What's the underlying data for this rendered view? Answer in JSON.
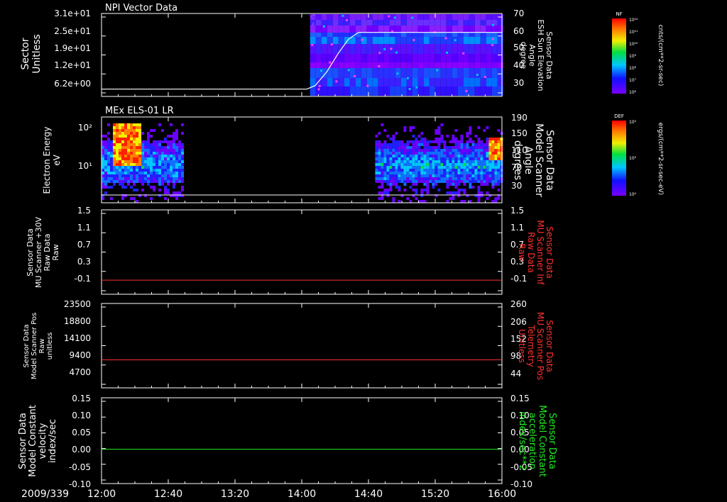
{
  "colors": {
    "background": "#000000",
    "foreground": "#ffffff",
    "red_line": "#ff3030",
    "green_line": "#22ee22"
  },
  "time_axis": {
    "date": "2009/339",
    "ticks": [
      "12:00",
      "12:40",
      "13:20",
      "14:00",
      "14:40",
      "15:20",
      "16:00"
    ]
  },
  "colorbars": [
    {
      "title": "NF",
      "unit": "cnts/(cm**2-sr-sec)",
      "tick_labels": [
        "10¹²",
        "10¹¹",
        "10¹⁰",
        "10⁹",
        "10⁸",
        "10⁷",
        "10⁶"
      ]
    },
    {
      "title": "DEF",
      "unit": "ergs/(cm**2-sr-sec-eV)",
      "tick_labels": [
        "10⁴",
        "10²",
        "10⁰"
      ]
    }
  ],
  "chart_data": [
    {
      "type": "heatmap",
      "title": "NPI Vector Data",
      "ylabel": [
        "Sector",
        "Unitless"
      ],
      "yticks": [
        "3.1e+01",
        "2.5e+01",
        "1.9e+01",
        "1.2e+01",
        "6.2e+00"
      ],
      "y2label": [
        "Sensor Data",
        "ESH Sun Elevation",
        "Angle",
        "degree"
      ],
      "y2ticks": [
        "70",
        "60",
        "50",
        "40",
        "30"
      ],
      "data_coverage_start": "14:05",
      "overlay_line": {
        "name": "ESH Sun Elevation Angle",
        "points": [
          [
            "12:00",
            26
          ],
          [
            "14:03",
            26
          ],
          [
            "14:08",
            28
          ],
          [
            "14:15",
            36
          ],
          [
            "14:22",
            47
          ],
          [
            "14:28",
            55
          ],
          [
            "14:34",
            59
          ],
          [
            "16:00",
            59
          ]
        ]
      }
    },
    {
      "type": "heatmap",
      "title": "MEx ELS-01 LR",
      "ylabel": [
        "Electron Energy",
        "eV"
      ],
      "yticks": [
        "10²",
        "10¹"
      ],
      "y2label": [
        "Sensor Data",
        "Model Scanner",
        "Angle",
        "degrees"
      ],
      "y2ticks": [
        "190",
        "150",
        "110",
        "70",
        "30"
      ],
      "data_coverage": [
        [
          "12:00",
          "12:48"
        ],
        [
          "14:44",
          "16:00"
        ]
      ],
      "overlay_line": {
        "name": "Model Scanner Angle",
        "points": [
          [
            "12:00",
            10
          ],
          [
            "16:00",
            10
          ]
        ]
      }
    },
    {
      "type": "line",
      "ylabel": [
        "Sensor Data",
        "MU Scanner +30V",
        "Raw Data",
        "Raw"
      ],
      "yticks": [
        "1.5",
        "1.1",
        "0.7",
        "0.3",
        "-0.1"
      ],
      "ylim": [
        -0.3,
        1.5
      ],
      "y2label": [
        "Sensor Data",
        "MU Scanner Inf",
        "Raw Data",
        "Raw"
      ],
      "y2ticks": [
        "1.5",
        "1.1",
        "0.7",
        "0.3",
        "-0.1"
      ],
      "series": [
        {
          "values": [
            0.0,
            0.0
          ]
        }
      ]
    },
    {
      "type": "line",
      "ylabel": [
        "Sensor Data",
        "Model Scanner Pos",
        "Raw",
        "unitless"
      ],
      "yticks": [
        "23500",
        "18800",
        "14100",
        "9400",
        "4700"
      ],
      "ylim": [
        0,
        23500
      ],
      "y2label": [
        "Sensor Data",
        "MU Scanner Pos",
        "Telemetry",
        "Unitless"
      ],
      "y2ticks": [
        "260",
        "206",
        "152",
        "98",
        "44"
      ],
      "series": [
        {
          "values": [
            7800,
            7800
          ]
        }
      ]
    },
    {
      "type": "line",
      "ylabel": [
        "Sensor Data",
        "Model Constant",
        "velocity",
        "index/sec"
      ],
      "yticks": [
        "0.15",
        "0.10",
        "0.05",
        "0.00",
        "-0.05",
        "-0.10"
      ],
      "ylim": [
        -0.1,
        0.15
      ],
      "y2label": [
        "Sensor Data",
        "Model Constant",
        "acceleration",
        "index/sec**2"
      ],
      "y2ticks": [
        "0.15",
        "0.10",
        "0.05",
        "0.00",
        "-0.05",
        "-0.10"
      ],
      "series": [
        {
          "values": [
            0.0,
            0.0
          ]
        }
      ]
    }
  ]
}
